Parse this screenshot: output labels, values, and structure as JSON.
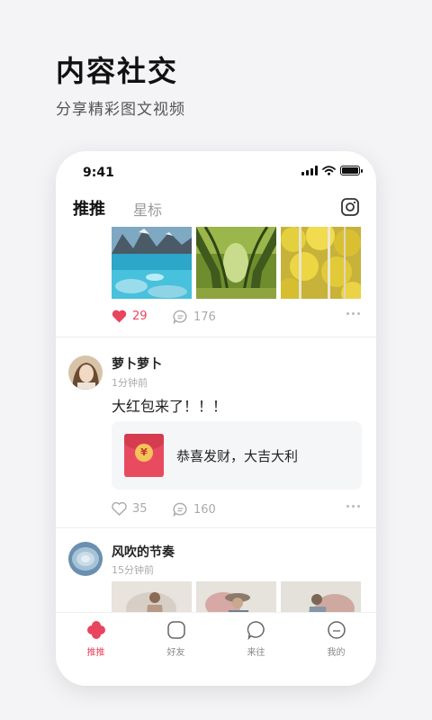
{
  "hero": {
    "title": "内容社交",
    "subtitle": "分享精彩图文视频"
  },
  "status_bar": {
    "time": "9:41"
  },
  "top_tabs": {
    "active": "推推",
    "other": "星标"
  },
  "posts": [
    {
      "likes": "29",
      "liked": true,
      "comments": "176"
    },
    {
      "username": "萝卜萝卜",
      "time_ago": "1分钟前",
      "text": "大红包来了！！！",
      "red_packet": {
        "symbol": "¥",
        "text": "恭喜发财，大吉大利"
      },
      "likes": "35",
      "liked": false,
      "comments": "160"
    },
    {
      "username": "风吹的节奏",
      "time_ago": "15分钟前"
    }
  ],
  "bottom_nav": [
    {
      "label": "推推",
      "icon": "flower-icon",
      "active": true
    },
    {
      "label": "好友",
      "icon": "friends-icon",
      "active": false
    },
    {
      "label": "来往",
      "icon": "chat-icon",
      "active": false
    },
    {
      "label": "我的",
      "icon": "profile-icon",
      "active": false
    }
  ],
  "colors": {
    "accent": "#e8455f",
    "background": "#f4f4f6"
  }
}
